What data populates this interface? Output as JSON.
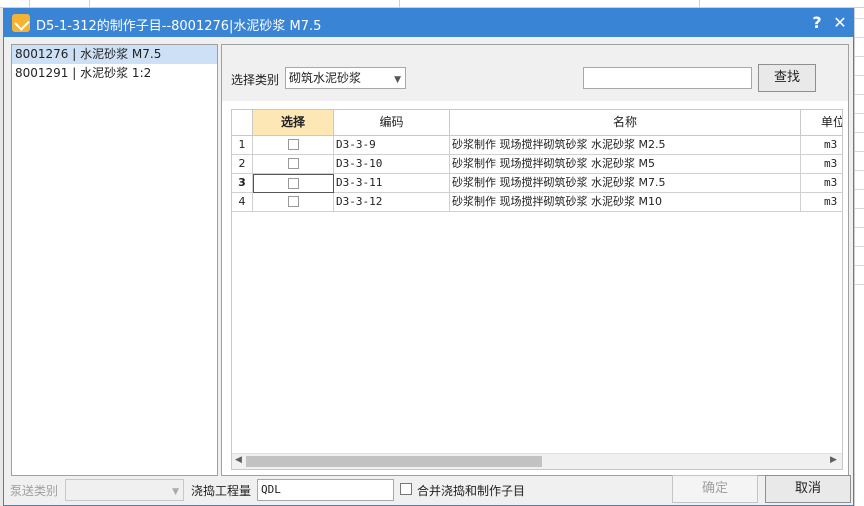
{
  "window": {
    "title": "D5-1-312的制作子目--8001276|水泥砂浆 M7.5",
    "help_label": "?",
    "close_label": "✕"
  },
  "left_list": {
    "items": [
      {
        "label": "8001276 | 水泥砂浆 M7.5",
        "selected": true
      },
      {
        "label": "8001291 | 水泥砂浆 1:2",
        "selected": false
      }
    ]
  },
  "filter": {
    "category_label": "选择类别",
    "category_value": "砌筑水泥砂浆",
    "search_value": "",
    "search_button": "查找"
  },
  "grid": {
    "columns": [
      "",
      "选择",
      "编码",
      "名称",
      "单位"
    ],
    "rows": [
      {
        "num": "1",
        "code": "D3-3-9",
        "name": "砂浆制作 现场搅拌砌筑砂浆 水泥砂浆 M2.5",
        "unit": "m3"
      },
      {
        "num": "2",
        "code": "D3-3-10",
        "name": "砂浆制作 现场搅拌砌筑砂浆 水泥砂浆 M5",
        "unit": "m3"
      },
      {
        "num": "3",
        "code": "D3-3-11",
        "name": "砂浆制作 现场搅拌砌筑砂浆 水泥砂浆 M7.5",
        "unit": "m3"
      },
      {
        "num": "4",
        "code": "D3-3-12",
        "name": "砂浆制作 现场搅拌砌筑砂浆 水泥砂浆 M10",
        "unit": "m3"
      }
    ],
    "current_row": "3"
  },
  "bottom": {
    "pump_label": "泵送类别",
    "pump_value": "",
    "pour_label": "浇捣工程量",
    "pour_value": "QDL",
    "merge_label": "合并浇捣和制作子目",
    "ok_label": "确定",
    "cancel_label": "取消"
  },
  "colors": {
    "titlebar": "#3a84d6",
    "selected_row": "#cde0f5",
    "selected_header": "#fde7b4"
  }
}
